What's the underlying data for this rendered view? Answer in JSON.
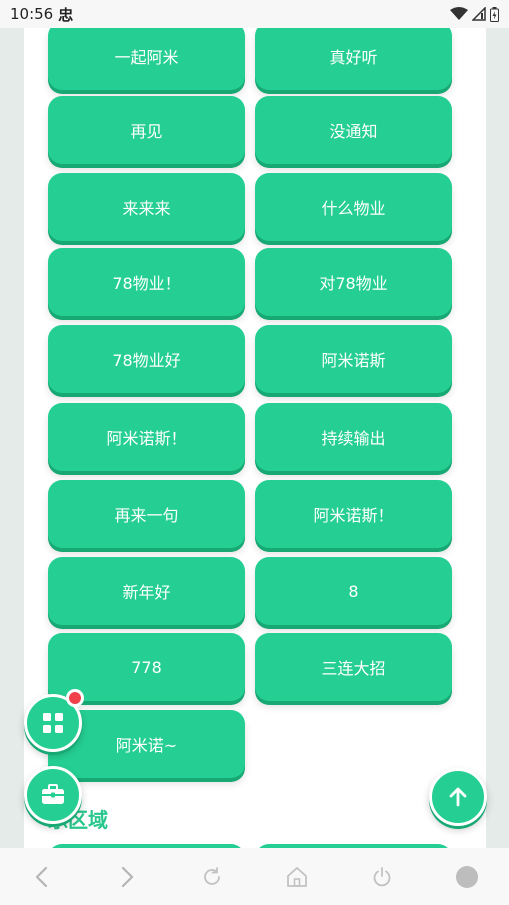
{
  "status_bar": {
    "time": "10:56",
    "alert_glyph": "忠",
    "icons": [
      "wifi-icon",
      "signal-icon",
      "battery-icon"
    ]
  },
  "buttons": [
    "一起阿米",
    "真好听",
    "再见",
    "没通知",
    "来来来",
    "什么物业",
    "78物业！",
    "对78物业",
    "78物业好",
    "阿米诺斯",
    "阿米诺斯！",
    "持续输出",
    "再来一句",
    "阿米诺斯！",
    "新年好",
    "8",
    "778",
    "三连大招",
    "阿米诺~"
  ],
  "section": {
    "title": "乐区域"
  },
  "floating_actions": [
    "apps-grid-icon",
    "toolbox-icon",
    "arrow-up-icon"
  ],
  "nav_bar": [
    "back-icon",
    "forward-icon",
    "refresh-icon",
    "home-icon",
    "power-icon",
    "dot-icon"
  ],
  "colors": {
    "accent": "#25cf93",
    "accent_shadow": "#17a874",
    "badge": "#f0414b",
    "section_title": "#27c78d"
  }
}
